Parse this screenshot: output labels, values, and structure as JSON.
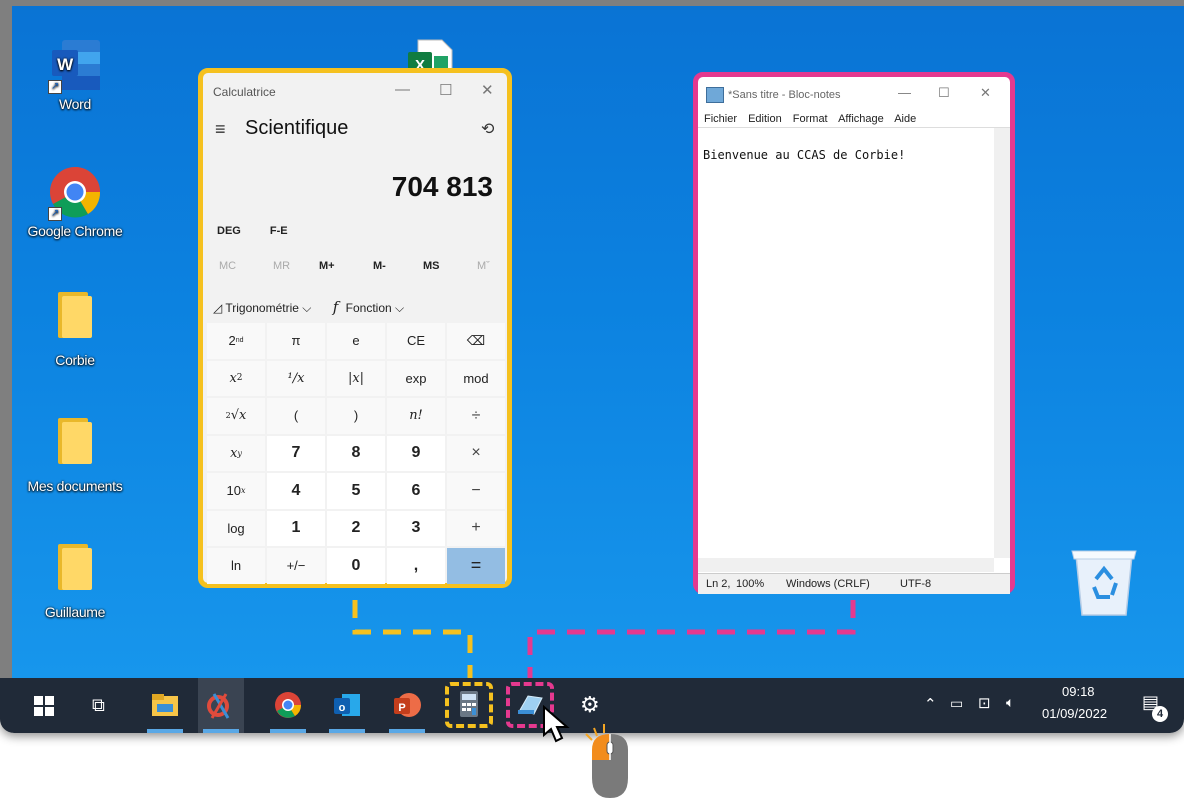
{
  "desktop_icons": [
    {
      "label": "Word",
      "icon": "word-icon"
    },
    {
      "label": "Google Chrome",
      "icon": "chrome-icon"
    },
    {
      "label": "Corbie",
      "icon": "folder-icon"
    },
    {
      "label": "Mes documents",
      "icon": "folder-icon"
    },
    {
      "label": "Guillaume",
      "icon": "folder-icon"
    }
  ],
  "calculator": {
    "title": "Calculatrice",
    "mode": "Scientifique",
    "display": "704 813",
    "deg": "DEG",
    "fe": "F-E",
    "memory": [
      "MC",
      "MR",
      "M+",
      "M-",
      "MS",
      "Mˇ"
    ],
    "trig": "Trigonométrie",
    "func": "Fonction",
    "keys": {
      "pi": "π",
      "e": "e",
      "ce": "CE",
      "exp": "exp",
      "mod": "mod",
      "lparen": "(",
      "rparen": ")",
      "nfact": "n!",
      "div": "÷",
      "mul": "×",
      "minus": "−",
      "plus": "+",
      "eq": "=",
      "log": "log",
      "ln": "ln",
      "plusminus": "+/−",
      "comma": ",",
      "abs": "|x|",
      "recip": "¹/x",
      "n0": "0",
      "n1": "1",
      "n2": "2",
      "n3": "3",
      "n4": "4",
      "n5": "5",
      "n6": "6",
      "n7": "7",
      "n8": "8",
      "n9": "9"
    }
  },
  "notepad": {
    "title": "*Sans titre - Bloc-notes",
    "menu": [
      "Fichier",
      "Edition",
      "Format",
      "Affichage",
      "Aide"
    ],
    "content": "Bienvenue au CCAS de Corbie!",
    "status": {
      "pos": "Ln 2,",
      "zoom": "100%",
      "eol": "Windows (CRLF)",
      "enc": "UTF-8"
    }
  },
  "taskbar": {
    "time": "09:18",
    "date": "01/09/2022",
    "notifications": "4"
  },
  "colors": {
    "calculator_highlight": "#f5c11f",
    "notepad_highlight": "#e5398f",
    "taskbar": "#202a38"
  }
}
